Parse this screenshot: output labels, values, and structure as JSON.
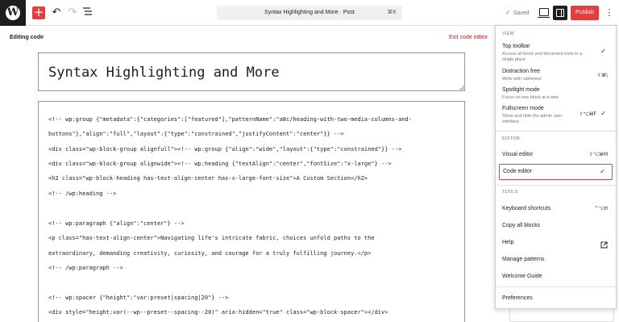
{
  "topbar": {
    "add_symbol": "+",
    "undo_symbol": "↶",
    "redo_symbol": "↷",
    "document_title": "Syntax Highlighting and More · Post",
    "title_shortcut": "⌘K",
    "saved_label": "Saved",
    "publish_label": "Publish",
    "more_symbol": "⋮"
  },
  "editor": {
    "editing_label": "Editing code",
    "exit_label": "Exit code editor",
    "post_title": "Syntax Highlighting and More",
    "code_lines": [
      "<!-- wp:group {\"metadata\":{\"categories\":[\"featured\"],\"patternName\":\"a8c/heading-with-two-media-columns-and-",
      "buttons\"},\"align\":\"full\",\"layout\":{\"type\":\"constrained\",\"justifyContent\":\"center\"}} -->",
      "<div class=\"wp-block-group alignfull\"><!-- wp:group {\"align\":\"wide\",\"layout\":{\"type\":\"constrained\"}} -->",
      "<div class=\"wp-block-group alignwide\"><!-- wp:heading {\"textAlign\":\"center\",\"fontSize\":\"x-large\"} -->",
      "<h2 class=\"wp-block-heading has-text-align-center has-x-large-font-size\">A Custom Section</h2>",
      "<!-- /wp:heading -->",
      "",
      "<!-- wp:paragraph {\"align\":\"center\"} -->",
      "<p class=\"has-text-align-center\">Navigating life's intricate fabric, choices unfold paths to the",
      "extraordinary, demanding creativity, curiosity, and courage for a truly fulfilling journey.</p>",
      "<!-- /wp:paragraph -->",
      "",
      "<!-- wp:spacer {\"height\":\"var:preset|spacing|20\"} -->",
      "<div style=\"height:var(--wp--preset--spacing--20)\" aria-hidden=\"true\" class=\"wp-block-spacer\"></div>"
    ]
  },
  "menu": {
    "view_heading": "View",
    "editor_heading": "Editor",
    "tools_heading": "Tools",
    "top_toolbar": {
      "label": "Top toolbar",
      "desc": "Access all block and document tools in a single place",
      "checked": "✓"
    },
    "distraction_free": {
      "label": "Distraction free",
      "desc": "Write with calmness",
      "shortcut": "⇧⌘\\"
    },
    "spotlight": {
      "label": "Spotlight mode",
      "desc": "Focus on one block at a time"
    },
    "fullscreen": {
      "label": "Fullscreen mode",
      "desc": "Show and hide the admin user interface",
      "shortcut": "⇧⌥⌘F",
      "checked": "✓"
    },
    "visual_editor": {
      "label": "Visual editor",
      "shortcut": "⇧⌥⌘M"
    },
    "code_editor": {
      "label": "Code editor",
      "checked": "✓"
    },
    "keyboard_shortcuts": {
      "label": "Keyboard shortcuts",
      "shortcut": "^⌥H"
    },
    "copy_all_blocks": {
      "label": "Copy all blocks"
    },
    "help": {
      "label": "Help",
      "icon": "external-link-icon"
    },
    "manage_patterns": {
      "label": "Manage patterns"
    },
    "welcome_guide": {
      "label": "Welcome Guide"
    },
    "preferences": {
      "label": "Preferences"
    }
  },
  "colors": {
    "accent": "#e63e3e",
    "exit_link": "#cc1818",
    "dark": "#1e1e1e"
  }
}
